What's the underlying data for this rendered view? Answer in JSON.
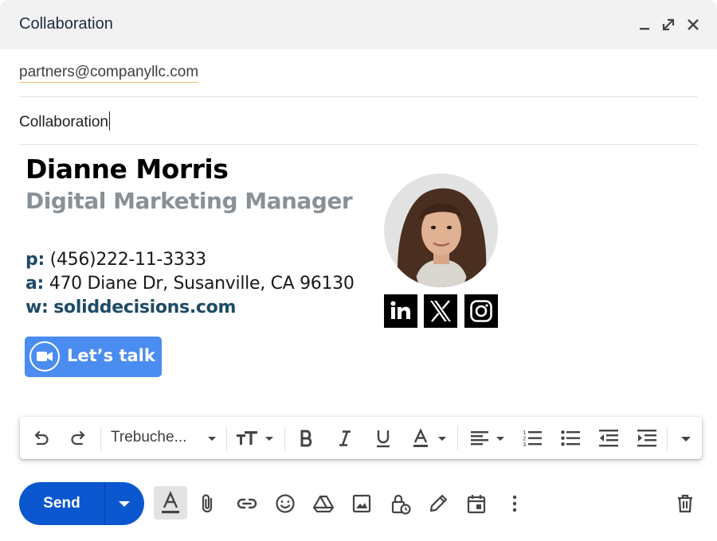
{
  "window": {
    "title": "Collaboration",
    "controls": [
      "minimize-icon",
      "expand-icon",
      "close-icon"
    ]
  },
  "recipients": {
    "to": "partners@companyllc.com"
  },
  "subject": {
    "value": "Collaboration"
  },
  "signature": {
    "name": "Dianne Morris",
    "job_title": "Digital Marketing Manager",
    "phone_label": "p:",
    "phone": "(456)222-11-3333",
    "address_label": "a:",
    "address": "470 Diane Dr, Susanville, CA 96130",
    "website_label": "w:",
    "website": "soliddecisions.com",
    "cta_label": "Let’s talk",
    "cta_icon": "video-camera-icon",
    "social": [
      "linkedin-icon",
      "x-icon",
      "instagram-icon"
    ],
    "name_color": "#000000",
    "title_color": "#8a9196",
    "accent_color": "#1d4b66",
    "cta_color": "#4a8cf0"
  },
  "format_toolbar": {
    "font_name": "Trebuche...",
    "items": [
      "undo-icon",
      "redo-icon",
      "font-select",
      "text-size-icon",
      "bold-icon",
      "italic-icon",
      "underline-icon",
      "text-color-icon",
      "align-icon",
      "numbered-list-icon",
      "bulleted-list-icon",
      "indent-less-icon",
      "indent-more-icon",
      "more-formatting-icon"
    ]
  },
  "bottom_toolbar": {
    "send_label": "Send",
    "send_color": "#0b57d0",
    "items": [
      "formatting-options-icon",
      "attach-icon",
      "link-icon",
      "emoji-icon",
      "drive-icon",
      "photo-icon",
      "confidential-icon",
      "signature-icon",
      "schedule-icon",
      "more-options-icon",
      "trash-icon"
    ]
  }
}
